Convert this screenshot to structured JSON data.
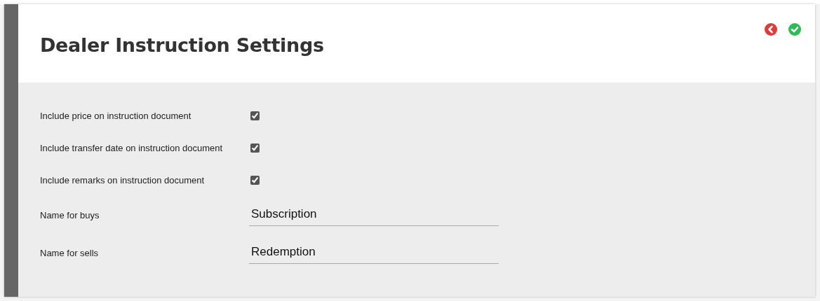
{
  "header": {
    "title": "Dealer Instruction Settings"
  },
  "settings": [
    {
      "kind": "checkbox",
      "label": "Include price on instruction document",
      "checked": true
    },
    {
      "kind": "checkbox",
      "label": "Include transfer date on instruction document",
      "checked": true
    },
    {
      "kind": "checkbox",
      "label": "Include remarks on instruction document",
      "checked": true
    },
    {
      "kind": "text",
      "label": "Name for buys",
      "value": "Subscription"
    },
    {
      "kind": "text",
      "label": "Name for sells",
      "value": "Redemption"
    }
  ]
}
